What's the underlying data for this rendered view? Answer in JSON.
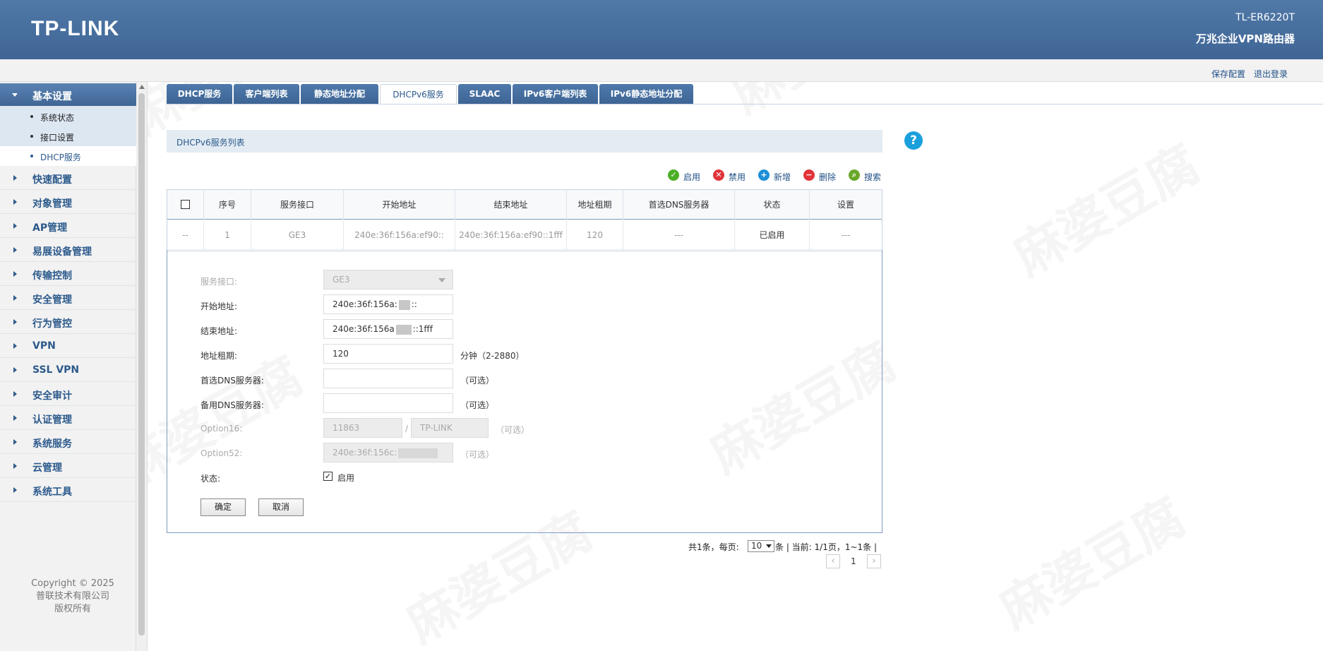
{
  "header": {
    "logo": "TP-LINK",
    "model": "TL-ER6220T",
    "product": "万兆企业VPN路由器"
  },
  "utilbar": {
    "save_config": "保存配置",
    "logout": "退出登录"
  },
  "sidebar": {
    "active_group": "基本设置",
    "sub_items": [
      "系统状态",
      "接口设置",
      "DHCP服务"
    ],
    "groups": [
      "快速配置",
      "对象管理",
      "AP管理",
      "易展设备管理",
      "传输控制",
      "安全管理",
      "行为管控",
      "VPN",
      "SSL VPN",
      "安全审计",
      "认证管理",
      "系统服务",
      "云管理",
      "系统工具"
    ],
    "copyright": [
      "Copyright © 2025",
      "普联技术有限公司",
      "版权所有"
    ]
  },
  "tabs": [
    "DHCP服务",
    "客户端列表",
    "静态地址分配",
    "DHCPv6服务",
    "SLAAC",
    "IPv6客户端列表",
    "IPv6静态地址分配"
  ],
  "active_tab": "DHCPv6服务",
  "section": {
    "title": "DHCPv6服务列表",
    "help": "?"
  },
  "actions": {
    "enable": "启用",
    "disable": "禁用",
    "add": "新增",
    "delete": "删除",
    "search": "搜索"
  },
  "table": {
    "headers": [
      "序号",
      "服务接口",
      "开始地址",
      "结束地址",
      "地址租期",
      "首选DNS服务器",
      "状态",
      "设置"
    ],
    "row": {
      "select": "--",
      "index": "1",
      "interface": "GE3",
      "start": "240e:36f:156a:ef90::",
      "end": "240e:36f:156a:ef90::1fff",
      "lease": "120",
      "dns": "---",
      "status": "已启用",
      "settings": "---"
    }
  },
  "form": {
    "interface_label": "服务接口:",
    "interface_value": "GE3",
    "start_label": "开始地址:",
    "start_value_prefix": "240e:36f:156a:",
    "start_value_suffix": "::",
    "end_label": "结束地址:",
    "end_value_prefix": "240e:36f:156a",
    "end_value_suffix": "::1fff",
    "lease_label": "地址租期:",
    "lease_value": "120",
    "lease_hint": "分钟（2-2880）",
    "dns1_label": "首选DNS服务器:",
    "dns1_hint": "（可选）",
    "dns2_label": "备用DNS服务器:",
    "dns2_hint": "（可选）",
    "opt16_label": "Option16:",
    "opt16_value1": "11863",
    "opt16_sep": "/",
    "opt16_value2": "TP-LINK",
    "opt16_hint": "（可选）",
    "opt52_label": "Option52:",
    "opt52_value": "240e:36f:156c:",
    "opt52_hint": "（可选）",
    "status_label": "状态:",
    "status_check": "✓",
    "status_text": "启用",
    "ok": "确定",
    "cancel": "取消"
  },
  "pager": {
    "summary_pre": "共1条，每页:",
    "page_size": "10",
    "summary_post": "条 | 当前: 1/1页，1~1条 |",
    "prev": "‹",
    "page": "1",
    "next": "›"
  },
  "watermark": "麻婆豆腐",
  "colors": {
    "header_blue": "#3f6595",
    "accent": "#2c5a8c",
    "help": "#1ba0dc",
    "enable_green": "#4caf27",
    "disable_red": "#e0343a",
    "add_blue": "#1e8ed6",
    "search_green": "#6aa82a"
  }
}
